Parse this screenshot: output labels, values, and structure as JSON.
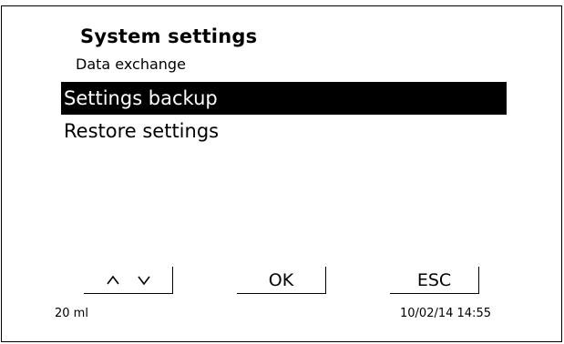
{
  "header": {
    "title": "System settings",
    "subtitle": "Data exchange"
  },
  "menu": {
    "items": [
      {
        "label": "Settings backup",
        "selected": true
      },
      {
        "label": "Restore settings",
        "selected": false
      }
    ]
  },
  "softkeys": {
    "updown": {
      "icons": [
        "chevron-up-icon",
        "chevron-down-icon"
      ]
    },
    "ok_label": "OK",
    "esc_label": "ESC"
  },
  "status": {
    "volume": "20 ml",
    "datetime": "10/02/14 14:55"
  },
  "colors": {
    "background": "#ffffff",
    "foreground": "#000000",
    "highlight": "#000000",
    "highlight_text": "#ffffff"
  }
}
